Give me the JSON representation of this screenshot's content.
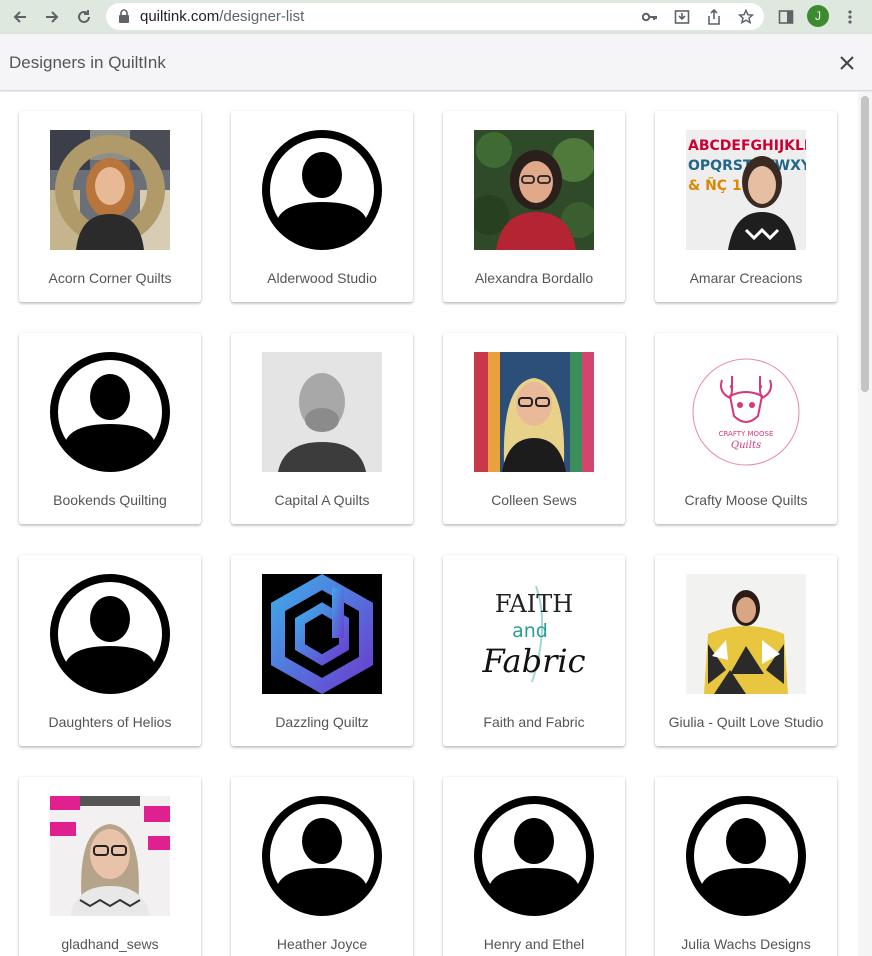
{
  "browser": {
    "url_host": "quiltink.com",
    "url_path": "/designer-list",
    "profile_initial": "J"
  },
  "dialog": {
    "title": "Designers in QuiltInk"
  },
  "designers": [
    {
      "name": "Acorn Corner Quilts",
      "avatar": "photo-woman-quilt"
    },
    {
      "name": "Alderwood Studio",
      "avatar": "default-user-icon"
    },
    {
      "name": "Alexandra Bordallo",
      "avatar": "photo-woman-glasses-garden"
    },
    {
      "name": "Amarar Creacions",
      "avatar": "photo-woman-alphabet-quilt"
    },
    {
      "name": "Bookends Quilting",
      "avatar": "default-user-icon"
    },
    {
      "name": "Capital A Quilts",
      "avatar": "photo-man-bw"
    },
    {
      "name": "Colleen Sews",
      "avatar": "photo-woman-blonde-glasses"
    },
    {
      "name": "Crafty Moose Quilts",
      "avatar": "logo-crafty-moose"
    },
    {
      "name": "Daughters of Helios",
      "avatar": "default-user-icon"
    },
    {
      "name": "Dazzling Quiltz",
      "avatar": "logo-dazzling-hexagon"
    },
    {
      "name": "Faith and Fabric",
      "avatar": "logo-faith-fabric"
    },
    {
      "name": "Giulia - Quilt Love Studio",
      "avatar": "photo-woman-triangle-quilt"
    },
    {
      "name": "gladhand_sews",
      "avatar": "photo-woman-pink-quilt"
    },
    {
      "name": "Heather Joyce",
      "avatar": "default-user-icon"
    },
    {
      "name": "Henry and Ethel",
      "avatar": "default-user-icon"
    },
    {
      "name": "Julia Wachs Designs",
      "avatar": "default-user-icon"
    }
  ],
  "logos": {
    "crafty_moose_line1": "CRAFTY MOOSE",
    "crafty_moose_line2": "Quilts",
    "faith_fabric_line1": "FAITH",
    "faith_fabric_line2": "and",
    "faith_fabric_line3": "Fabric"
  },
  "colors": {
    "chrome_bg": "#dee8df",
    "header_bg": "#f5f5f7",
    "label_text": "#555555",
    "profile_green": "#3c8b2e",
    "moose_pink": "#d6377e",
    "faith_teal": "#2a9d9a"
  }
}
